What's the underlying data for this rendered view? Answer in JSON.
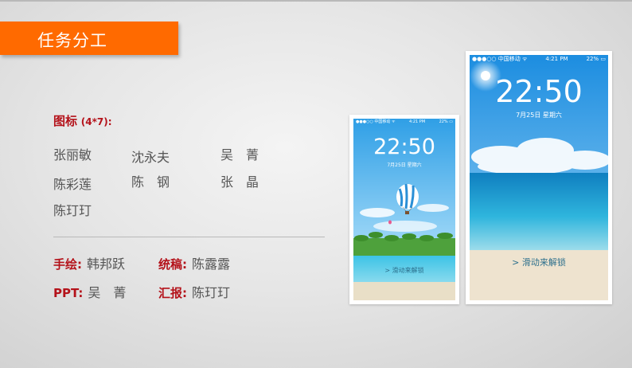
{
  "slide": {
    "title": "任务分工",
    "icons_label": "图标",
    "icons_count": "(4*7):",
    "names": {
      "col1": [
        "张丽敏",
        "陈彩莲",
        "陈玎玎"
      ],
      "col2": [
        "沈永夫",
        "陈　钢"
      ],
      "col3": [
        "吴　菁",
        "张　晶"
      ]
    },
    "roles": [
      {
        "label": "手绘:",
        "value": "韩邦跃"
      },
      {
        "label": "统稿:",
        "value": "陈露露"
      },
      {
        "label": "PPT:",
        "value": "吴　菁"
      },
      {
        "label": "汇报:",
        "value": "陈玎玎"
      }
    ]
  },
  "phones": {
    "small": {
      "carrier": "●●●○○ 中国移动 ᯤ",
      "time_bar": "4:21 PM",
      "battery": "22% ▭",
      "clock": "22:50",
      "date": "7月25日  星期六",
      "unlock": "> 滑动来解锁"
    },
    "large": {
      "carrier": "●●●○○ 中国移动 ᯤ",
      "time_bar": "4:21 PM",
      "battery": "22% ▭",
      "clock": "22:50",
      "date": "7月25日  星期六",
      "unlock": "> 滑动来解锁"
    }
  },
  "colors": {
    "accent": "#ff6a00",
    "label_red": "#b4121a",
    "text_grey": "#555555"
  }
}
